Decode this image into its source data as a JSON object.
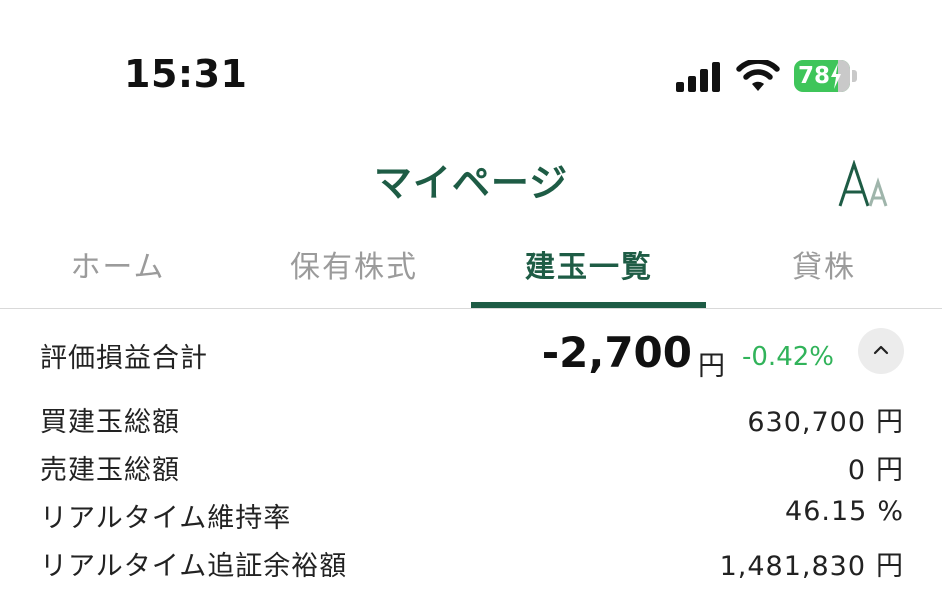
{
  "status_bar": {
    "time": "15:31",
    "battery_level": "78",
    "icons": [
      "cellular-signal-icon",
      "wifi-icon",
      "battery-charging-icon"
    ]
  },
  "nav": {
    "title": "マイページ",
    "font_size_icon": "font-size-icon"
  },
  "tabs": [
    {
      "label": "ホーム",
      "active": false
    },
    {
      "label": "保有株式",
      "active": false
    },
    {
      "label": "建玉一覧",
      "active": true
    },
    {
      "label": "貸株",
      "active": false
    }
  ],
  "summary": {
    "label": "評価損益合計",
    "value": "-2,700",
    "unit": "円",
    "percent": "-0.42%",
    "toggle_icon": "chevron-up-icon"
  },
  "details": [
    {
      "label": "買建玉総額",
      "value": "630,700",
      "unit": "円"
    },
    {
      "label": "売建玉総額",
      "value": "0",
      "unit": "円"
    },
    {
      "label": "リアルタイム維持率",
      "value": "46.15",
      "unit": "%"
    },
    {
      "label": "リアルタイム追証余裕額",
      "value": "1,481,830",
      "unit": "円"
    }
  ],
  "colors": {
    "brand": "#1e5c45",
    "positive_percent": "#31b35a",
    "battery": "#3fc55a",
    "inactive_tab": "#9b9b9b"
  }
}
